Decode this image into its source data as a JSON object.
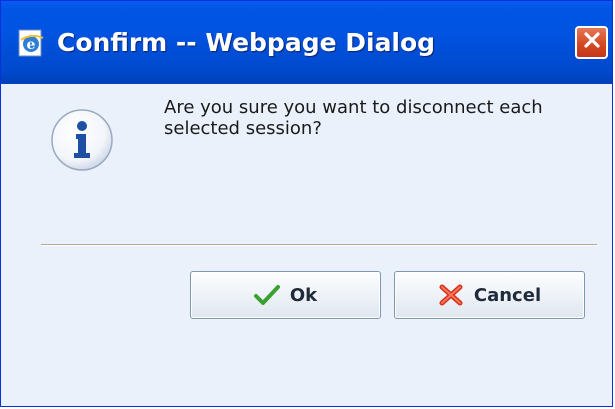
{
  "dialog": {
    "title": "Confirm -- Webpage Dialog",
    "message": "Are you sure you want to disconnect each selected session?",
    "icon": "info-icon",
    "buttons": {
      "ok_label": "Ok",
      "ok_icon": "checkmark-icon",
      "cancel_label": "Cancel",
      "cancel_icon": "cross-icon"
    }
  },
  "colors": {
    "titlebar": "#0153e0",
    "close_button": "#d44a21",
    "content_background": "#eaf1fb",
    "info_icon": "#1e4fa3",
    "ok_check": "#3aa030",
    "cancel_cross": "#d9301c"
  }
}
